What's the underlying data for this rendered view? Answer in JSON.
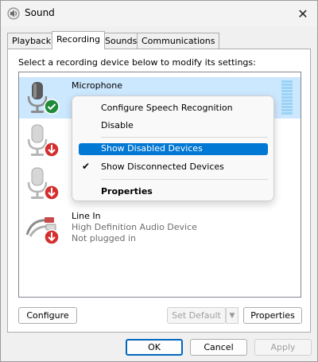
{
  "window": {
    "title": "Sound",
    "icon": "speaker-icon",
    "close_glyph": "✕"
  },
  "tabs": [
    {
      "label": "Playback",
      "active": false
    },
    {
      "label": "Recording",
      "active": true
    },
    {
      "label": "Sounds",
      "active": false
    },
    {
      "label": "Communications",
      "active": false
    }
  ],
  "panel": {
    "instruction": "Select a recording device below to modify its settings:"
  },
  "devices": [
    {
      "name": "Microphone",
      "status_icon": "green-check-icon",
      "selected": true
    },
    {
      "name": "",
      "status_icon": "red-down-arrow-icon",
      "selected": false
    },
    {
      "name": "",
      "status_icon": "red-down-arrow-icon",
      "selected": false
    },
    {
      "name": "Line In",
      "line2": "High Definition Audio Device",
      "line3": "Not plugged in",
      "status_icon": "red-down-arrow-icon",
      "selected": false
    }
  ],
  "context_menu": {
    "items": [
      {
        "label": "Configure Speech Recognition"
      },
      {
        "label": "Disable"
      },
      {
        "label": "Show Disabled Devices",
        "highlighted": true
      },
      {
        "label": "Show Disconnected Devices",
        "checked": true,
        "check_glyph": "✔"
      },
      {
        "label": "Properties",
        "bold": true
      }
    ]
  },
  "panel_buttons": {
    "configure": "Configure",
    "set_default": "Set Default",
    "set_default_arrow": "▼",
    "properties": "Properties"
  },
  "dialog_buttons": {
    "ok": "OK",
    "cancel": "Cancel",
    "apply": "Apply"
  },
  "colors": {
    "accent": "#0078d4",
    "selection": "#cce8ff",
    "check_green": "#1e8a3a",
    "arrow_red": "#d32f2f"
  }
}
